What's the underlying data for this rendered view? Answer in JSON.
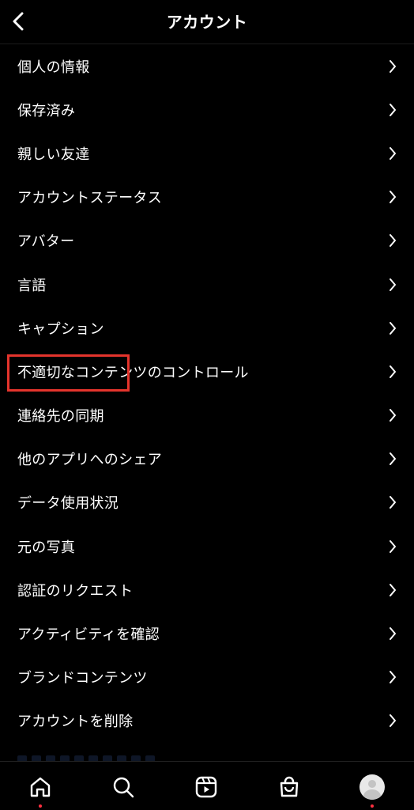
{
  "header": {
    "title": "アカウント",
    "back_icon": "chevron-left-icon"
  },
  "menu": {
    "items": [
      {
        "label": "個人の情報"
      },
      {
        "label": "保存済み"
      },
      {
        "label": "親しい友達"
      },
      {
        "label": "アカウントステータス"
      },
      {
        "label": "アバター"
      },
      {
        "label": "言語"
      },
      {
        "label": "キャプション"
      },
      {
        "label": "不適切なコンテンツのコントロール"
      },
      {
        "label": "連絡先の同期",
        "highlighted": true
      },
      {
        "label": "他のアプリへのシェア"
      },
      {
        "label": "データ使用状況"
      },
      {
        "label": "元の写真"
      },
      {
        "label": "認証のリクエスト"
      },
      {
        "label": "アクティビティを確認"
      },
      {
        "label": "ブランドコンテンツ"
      },
      {
        "label": "アカウントを削除"
      }
    ],
    "chevron_icon": "chevron-right-icon"
  },
  "highlight_color": "#e4342c",
  "bottom_nav": {
    "items": [
      {
        "icon": "home-icon",
        "active": true
      },
      {
        "icon": "search-icon"
      },
      {
        "icon": "reels-icon"
      },
      {
        "icon": "shop-icon"
      },
      {
        "icon": "profile-avatar",
        "notification_dot": true
      }
    ]
  }
}
